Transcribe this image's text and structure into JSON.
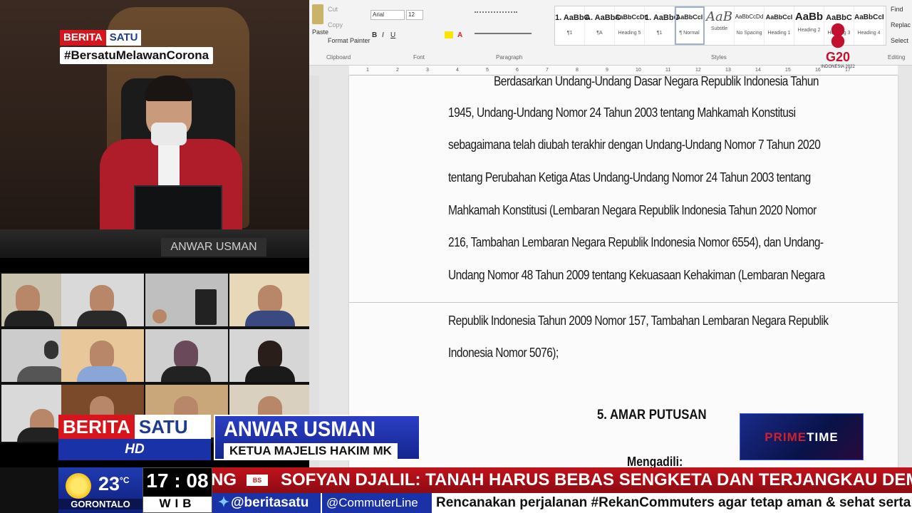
{
  "broadcast": {
    "channel_part1": "BERITA",
    "channel_part2": "SATU",
    "hashtag": "#BersatuMelawanCorona",
    "nameplate": "ANWAR USMAN",
    "hd_label": "HD",
    "lower_third": {
      "name": "ANWAR USMAN",
      "title": "KETUA MAJELIS HAKIM MK"
    },
    "program_logo": {
      "part1": "PRIME",
      "part2": "TIME"
    },
    "weather": {
      "temp": "23",
      "unit": "°C",
      "city": "GORONTALO"
    },
    "clock": {
      "time": "17 : 08",
      "zone": "WIB"
    },
    "ticker": {
      "prefix": "NG",
      "mini_logo": "BS",
      "headline": "SOFYAN DJALIL: TANAH HARUS BEBAS SENGKETA DAN TERJANGKAU DEMI INF",
      "handle1": "@beritasatu",
      "handle2": "@CommuterLine",
      "crawl": "Rencanakan perjalanan #RekanCommuters agar tetap aman & sehat serta t"
    },
    "g20": {
      "text": "G20",
      "sub": "INDONESIA 2022"
    }
  },
  "word": {
    "font_name": "Arial",
    "font_size": "12",
    "groups": {
      "clipboard": "Clipboard",
      "font": "Font",
      "paragraph": "Paragraph",
      "styles": "Styles",
      "editing": "Editing"
    },
    "clipboard_items": {
      "paste": "Paste",
      "cut": "Cut",
      "copy": "Copy",
      "format_painter": "Format Painter"
    },
    "editing_items": {
      "find": "Find",
      "replace": "Replac",
      "select": "Select"
    },
    "styles": [
      {
        "preview": "1. AaBbC",
        "label": "¶1"
      },
      {
        "preview": "A. AaBbC",
        "label": "¶A"
      },
      {
        "preview": "AaBbCcDt",
        "label": "Heading 5"
      },
      {
        "preview": "1. AaBbC",
        "label": "¶1"
      },
      {
        "preview": "AaBbCcI",
        "label": "¶ Normal"
      },
      {
        "preview": "AaB",
        "label": "Subtitle"
      },
      {
        "preview": "AaBbCcDd",
        "label": "No Spacing"
      },
      {
        "preview": "AaBbCcI",
        "label": "Heading 1"
      },
      {
        "preview": "AaBb",
        "label": "Heading 2"
      },
      {
        "preview": "AaBbC",
        "label": "Heading 3"
      },
      {
        "preview": "AaBbCcI",
        "label": "Heading 4"
      }
    ],
    "ruler_ticks": [
      "1",
      "2",
      "3",
      "4",
      "5",
      "6",
      "7",
      "8",
      "9",
      "10",
      "11",
      "12",
      "13",
      "14",
      "15",
      "16",
      "17"
    ],
    "document_lines": [
      "Berdasarkan Undang-Undang Dasar Negara Republik Indonesia Tahun",
      "1945, Undang-Undang Nomor 24 Tahun 2003 tentang Mahkamah Konstitusi",
      "sebagaimana telah diubah terakhir dengan Undang-Undang Nomor 7 Tahun 2020",
      "tentang Perubahan Ketiga Atas Undang-Undang Nomor 24 Tahun 2003 tentang",
      "Mahkamah Konstitusi (Lembaran Negara Republik Indonesia Tahun 2020 Nomor",
      "216, Tambahan Lembaran Negara Republik Indonesia Nomor 6554), dan Undang-",
      "Undang Nomor 48 Tahun 2009 tentang Kekuasaan Kehakiman (Lembaran Negara",
      "Republik Indonesia Tahun 2009 Nomor 157, Tambahan Lembaran Negara Republik",
      "Indonesia Nomor 5076);"
    ],
    "heading": "5. AMAR PUTUSAN",
    "subheading": "Mengadili:"
  },
  "colors": {
    "brand_red": "#d7151c",
    "brand_blue": "#1f3c8c",
    "ticker_red": "#c2121b"
  }
}
